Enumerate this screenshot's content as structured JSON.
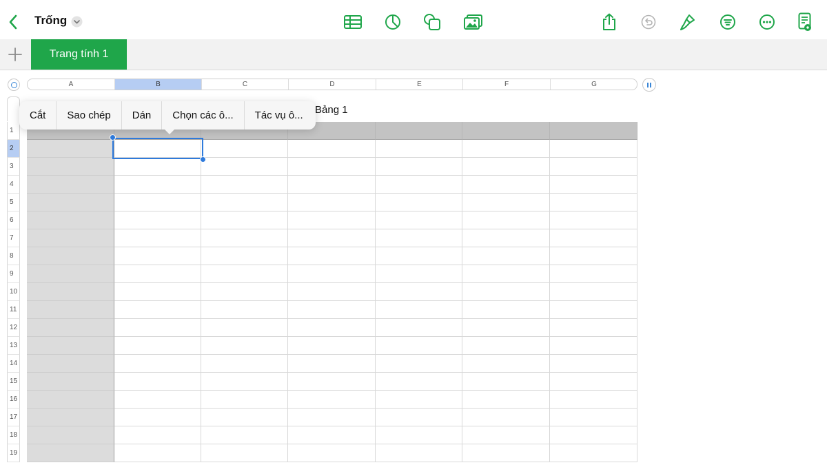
{
  "toolbar": {
    "document_title": "Trống",
    "accent_color": "#1fa64a",
    "icons": {
      "back": "chevron-left-icon",
      "title_menu": "chevron-down-circle-icon",
      "insert_table": "table-icon",
      "insert_chart": "chart-pie-icon",
      "insert_shape": "shape-icon",
      "insert_media": "media-icon",
      "share": "share-icon",
      "undo": "undo-icon",
      "format": "paintbrush-icon",
      "organize": "filter-icon",
      "more": "more-icon",
      "view": "document-view-icon"
    }
  },
  "sheets": {
    "add_icon": "plus-icon",
    "tabs": [
      {
        "label": "Trang tính 1",
        "active": true
      }
    ]
  },
  "grid": {
    "column_headers": [
      "A",
      "B",
      "C",
      "D",
      "E",
      "F",
      "G"
    ],
    "row_headers": [
      "1",
      "2",
      "3",
      "4",
      "5",
      "6",
      "7",
      "8",
      "9",
      "10",
      "11",
      "12",
      "13",
      "14",
      "15",
      "16",
      "17",
      "18",
      "19"
    ],
    "selected_column": "B",
    "selected_row": "2",
    "selected_cell": "B2",
    "table_title": "Bảng 1",
    "selection_color": "#2f7bdc",
    "header_highlight_color": "#b6cdf3"
  },
  "context_menu": {
    "items": [
      "Cắt",
      "Sao chép",
      "Dán",
      "Chọn các ô...",
      "Tác vụ ô..."
    ]
  }
}
